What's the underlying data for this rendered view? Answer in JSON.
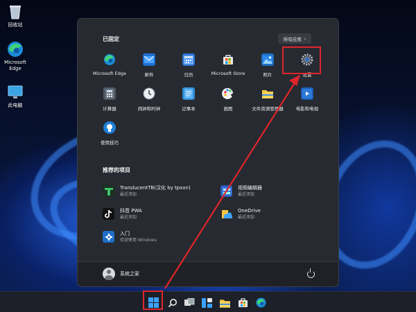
{
  "desktop": {
    "icons": [
      {
        "label": "回收站",
        "icon": "recycle-bin-icon"
      },
      {
        "label": "Microsoft Edge",
        "icon": "edge-icon"
      },
      {
        "label": "此电脑",
        "icon": "this-pc-icon"
      }
    ]
  },
  "start_menu": {
    "pinned_title": "已固定",
    "all_apps_label": "所有应用",
    "all_apps_chevron": "›",
    "pinned_apps": [
      {
        "label": "Microsoft Edge",
        "icon": "edge-icon"
      },
      {
        "label": "邮件",
        "icon": "mail-icon"
      },
      {
        "label": "日历",
        "icon": "calendar-icon"
      },
      {
        "label": "Microsoft Store",
        "icon": "store-icon"
      },
      {
        "label": "照片",
        "icon": "photos-icon"
      },
      {
        "label": "设置",
        "icon": "gear-icon"
      },
      {
        "label": "计算器",
        "icon": "calculator-icon"
      },
      {
        "label": "闹钟和时钟",
        "icon": "clock-icon"
      },
      {
        "label": "记事本",
        "icon": "notepad-icon"
      },
      {
        "label": "画图",
        "icon": "paint-icon"
      },
      {
        "label": "文件资源管理器",
        "icon": "folder-icon"
      },
      {
        "label": "电影和电视",
        "icon": "movies-icon"
      },
      {
        "label": "使用技巧",
        "icon": "tips-icon"
      }
    ],
    "recommended_title": "推荐的项目",
    "recommended": [
      {
        "title": "TranslucentTB(汉化 by tpxxn)",
        "subtitle": "最近添加",
        "icon": "translucenttb-icon"
      },
      {
        "title": "视频编辑器",
        "subtitle": "最近添加",
        "icon": "video-editor-icon"
      },
      {
        "title": "抖音 PWA",
        "subtitle": "最近添加",
        "icon": "douyin-icon"
      },
      {
        "title": "OneDrive",
        "subtitle": "最近添加",
        "icon": "onedrive-icon"
      },
      {
        "title": "入门",
        "subtitle": "欢迎使用 Windows",
        "icon": "get-started-icon"
      }
    ],
    "user_name": "系统之家"
  },
  "taskbar": {
    "icons": [
      "start-icon",
      "search-icon",
      "task-view-icon",
      "widgets-icon",
      "file-explorer-icon",
      "store-icon",
      "edge-icon"
    ]
  },
  "annotation_color": "#e0262b"
}
